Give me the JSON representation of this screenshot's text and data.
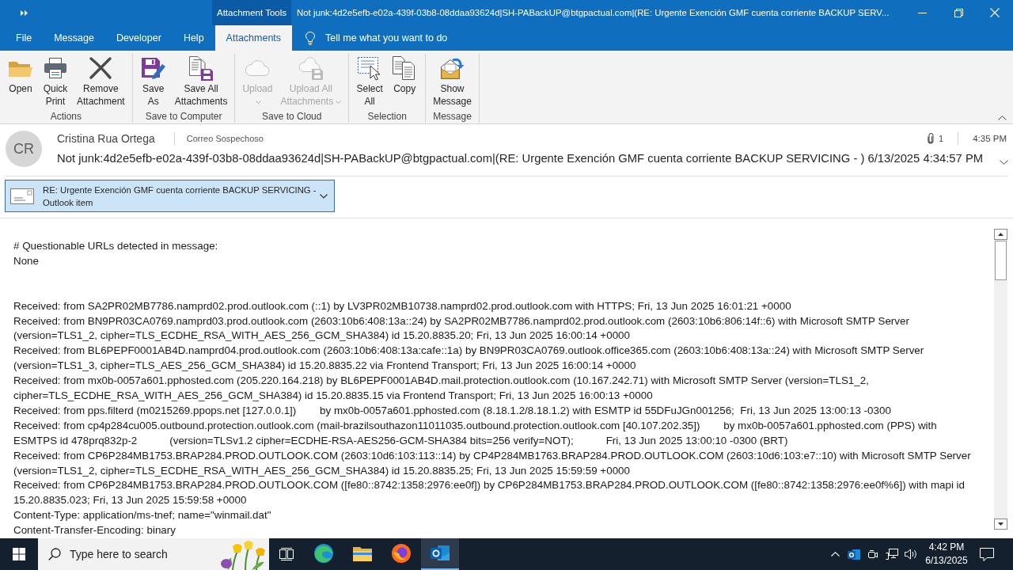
{
  "title_bar": {
    "contextual_tab": "Attachment Tools",
    "title": "Not junk:4d2e5efb-e02a-439f-03b8-08ddaa93624d|SH-PABackUP@btgpactual.com|(RE: Urgente Exención GMF cuenta corriente BACKUP SERV..."
  },
  "ribbon_tabs": [
    {
      "label": "File",
      "selected": false
    },
    {
      "label": "Message",
      "selected": false
    },
    {
      "label": "Developer",
      "selected": false
    },
    {
      "label": "Help",
      "selected": false
    },
    {
      "label": "Attachments",
      "selected": true
    }
  ],
  "tell_me": {
    "placeholder": "Tell me what you want to do"
  },
  "ribbon": {
    "groups": [
      {
        "label": "Actions",
        "buttons": [
          {
            "label": "Open",
            "disabled": false,
            "has_menu": false
          },
          {
            "label": "Quick Print",
            "disabled": false,
            "has_menu": false
          },
          {
            "label": "Remove Attachment",
            "disabled": false,
            "has_menu": false
          }
        ]
      },
      {
        "label": "Save to Computer",
        "buttons": [
          {
            "label": "Save As",
            "disabled": false,
            "has_menu": false
          },
          {
            "label": "Save All Attachments",
            "disabled": false,
            "has_menu": false
          }
        ]
      },
      {
        "label": "Save to Cloud",
        "buttons": [
          {
            "label": "Upload",
            "disabled": true,
            "has_menu": true
          },
          {
            "label": "Upload All Attachments",
            "disabled": true,
            "has_menu": true
          }
        ]
      },
      {
        "label": "Selection",
        "buttons": [
          {
            "label": "Select All",
            "disabled": false,
            "has_menu": false
          },
          {
            "label": "Copy",
            "disabled": false,
            "has_menu": false
          }
        ]
      },
      {
        "label": "Message",
        "buttons": [
          {
            "label": "Show Message",
            "disabled": false,
            "has_menu": false
          }
        ]
      }
    ]
  },
  "message": {
    "sender": {
      "initials": "CR",
      "name": "Cristina Rua Ortega"
    },
    "folder": "Correo Sospechoso",
    "attachment_count": "1",
    "time": "4:35 PM",
    "subject": "Not junk:4d2e5efb-e02a-439f-03b8-08ddaa93624d|SH-PABackUP@btgpactual.com|(RE: Urgente Exención GMF cuenta corriente BACKUP SERVICING - ) 6/13/2025 4:34:57 PM"
  },
  "attachment": {
    "name": "RE: Urgente Exención GMF cuenta corriente BACKUP SERVICING -",
    "type": "Outlook item",
    "selected": true
  },
  "body": {
    "sections": [
      {
        "paragraphs": [
          {
            "lines": [
              "# Questionable URLs detected in message:"
            ]
          },
          {
            "lines": [
              "None"
            ]
          }
        ]
      },
      {
        "paragraphs": [
          {
            "lines": [
              "Received: from SA2PR02MB7786.namprd02.prod.outlook.com (::1) by LV3PR02MB10738.namprd02.prod.outlook.com with HTTPS; Fri, 13 Jun 2025 16:01:21 +0000"
            ]
          },
          {
            "lines": [
              "Received: from BN9PR03CA0769.namprd03.prod.outlook.com (2603:10b6:408:13a::24) by SA2PR02MB7786.namprd02.prod.outlook.com (2603:10b6:806:14f::6) with Microsoft SMTP Server",
              "(version=TLS1_2, cipher=TLS_ECDHE_RSA_WITH_AES_256_GCM_SHA384) id 15.20.8835.20; Fri, 13 Jun 2025 16:00:14 +0000"
            ]
          },
          {
            "lines": [
              "Received: from BL6PEPF0001AB4D.namprd04.prod.outlook.com (2603:10b6:408:13a:cafe::1a) by BN9PR03CA0769.outlook.office365.com (2603:10b6:408:13a::24) with Microsoft SMTP Server",
              "(version=TLS1_3, cipher=TLS_AES_256_GCM_SHA384) id 15.20.8835.22 via Frontend Transport; Fri, 13 Jun 2025 16:00:14 +0000"
            ]
          },
          {
            "lines": [
              "Received: from mx0b-0057a601.pphosted.com (205.220.164.218) by BL6PEPF0001AB4D.mail.protection.outlook.com (10.167.242.71) with Microsoft SMTP Server (version=TLS1_2,",
              "cipher=TLS_ECDHE_RSA_WITH_AES_256_GCM_SHA384) id 15.20.8835.15 via Frontend Transport; Fri, 13 Jun 2025 16:00:13 +0000"
            ]
          },
          {
            "lines": [
              "Received: from pps.filterd (m0215269.ppops.net [127.0.0.1])        by mx0b-0057a601.pphosted.com (8.18.1.2/8.18.1.2) with ESMTP id 55DFuJGn001256;  Fri, 13 Jun 2025 13:00:13 -0300"
            ]
          },
          {
            "lines": [
              "Received: from cp4p284cu005.outbound.protection.outlook.com (mail-brazilsouthazon11011035.outbound.protection.outlook.com [40.107.202.35])        by mx0b-0057a601.pphosted.com (PPS) with",
              "ESMTPS id 478prq832p-2           (version=TLSv1.2 cipher=ECDHE-RSA-AES256-GCM-SHA384 bits=256 verify=NOT);           Fri, 13 Jun 2025 13:00:10 -0300 (BRT)"
            ]
          },
          {
            "lines": [
              "Received: from CP6P284MB1753.BRAP284.PROD.OUTLOOK.COM (2603:10d6:103:113::14) by CP4P284MB1763.BRAP284.PROD.OUTLOOK.COM (2603:10d6:103:e7::10) with Microsoft SMTP Server",
              "(version=TLS1_2, cipher=TLS_ECDHE_RSA_WITH_AES_256_GCM_SHA384) id 15.20.8835.25; Fri, 13 Jun 2025 15:59:59 +0000"
            ]
          },
          {
            "lines": [
              "Received: from CP6P284MB1753.BRAP284.PROD.OUTLOOK.COM ([fe80::8742:1358:2976:ee0f]) by CP6P284MB1753.BRAP284.PROD.OUTLOOK.COM ([fe80::8742:1358:2976:ee0f%6]) with mapi id",
              "15.20.8835.023; Fri, 13 Jun 2025 15:59:58 +0000"
            ]
          },
          {
            "lines": [
              "Content-Type: application/ms-tnef; name=\"winmail.dat\""
            ]
          },
          {
            "lines": [
              "Content-Transfer-Encoding: binary"
            ]
          }
        ]
      }
    ]
  },
  "taskbar": {
    "search": {
      "placeholder": "Type here to search"
    },
    "apps": [
      {
        "selected": false
      },
      {
        "selected": false
      },
      {
        "selected": false
      },
      {
        "selected": true
      }
    ],
    "clock": {
      "time": "4:42 PM",
      "date": "6/13/2025"
    }
  }
}
